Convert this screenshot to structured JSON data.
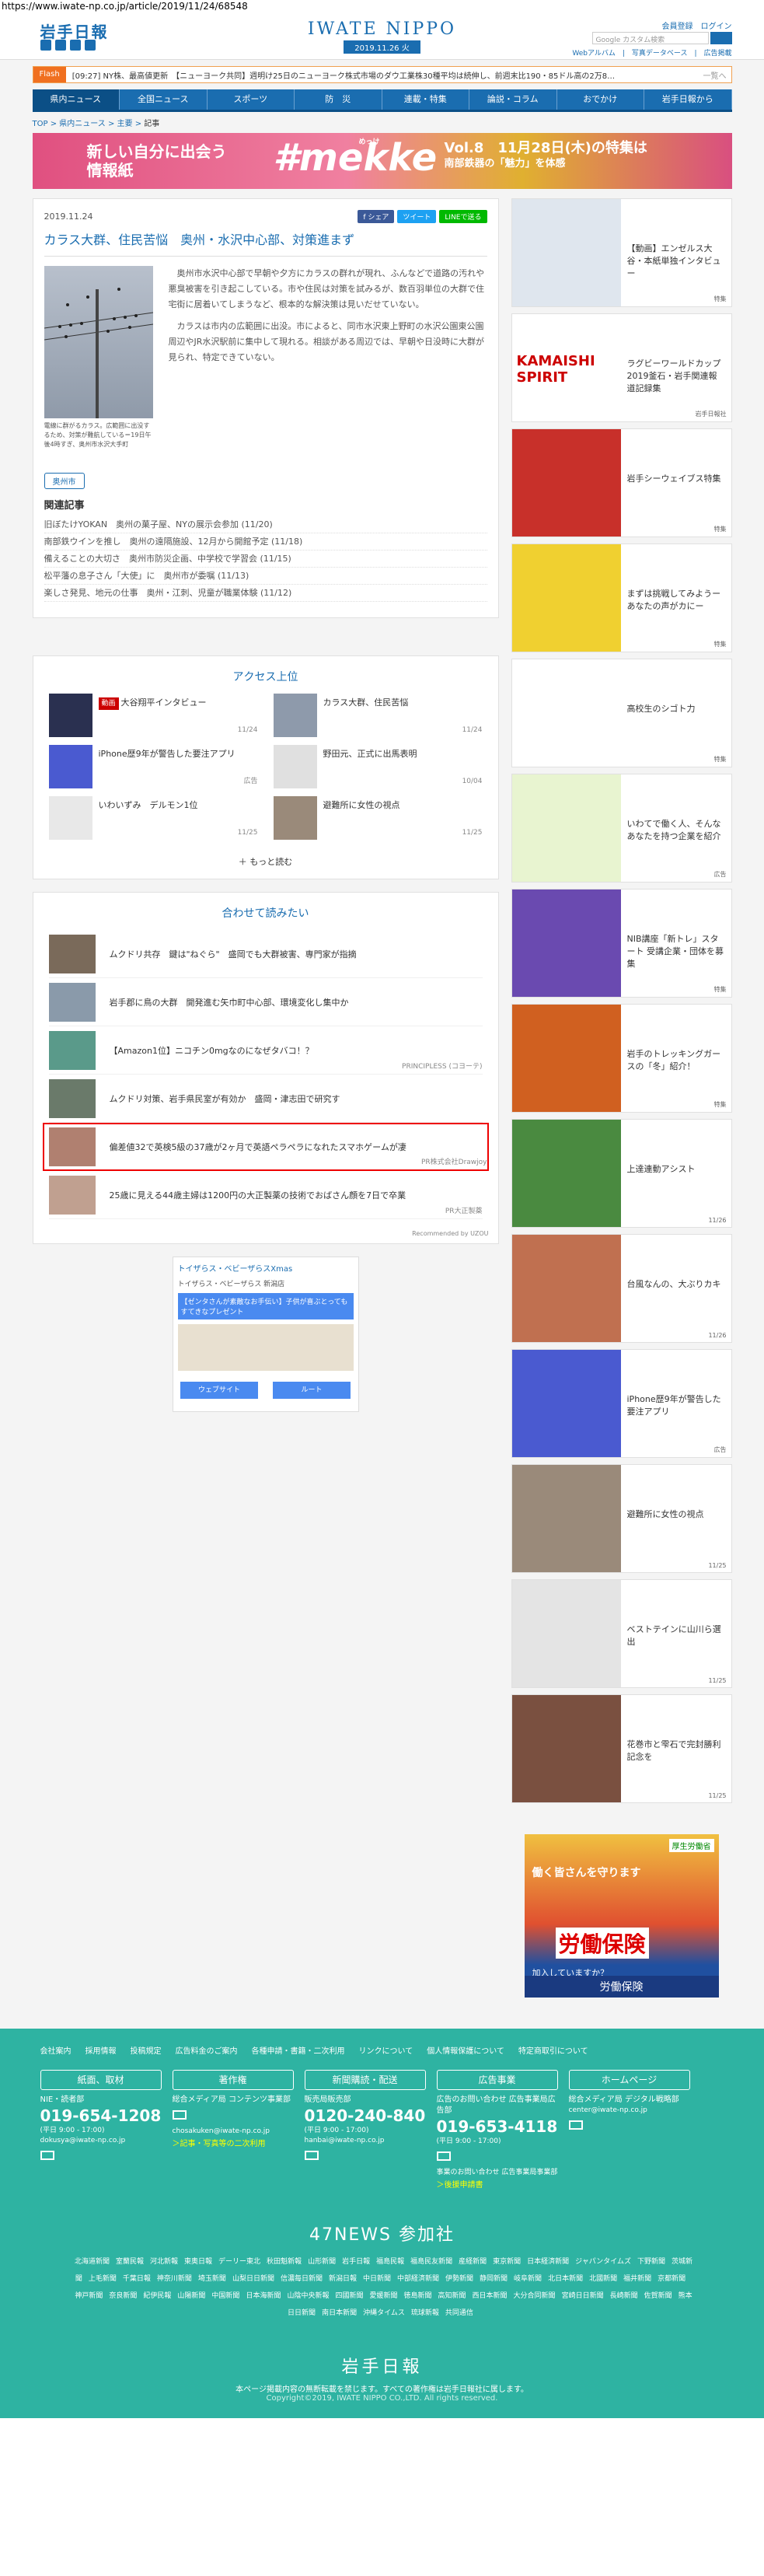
{
  "url": "https://www.iwate-np.co.jp/article/2019/11/24/68548",
  "header": {
    "logo": "岩手日報",
    "brand": "IWATE NIPPO",
    "date": "2019.11.26 火",
    "account": "会員登録　ログイン",
    "search_placeholder": "Google カスタム検索",
    "links": "Webアルバム　|　写真データベース　|　広告掲載"
  },
  "flash": {
    "tag": "Flash",
    "time": "[09:27]",
    "text": "NY株、最高値更新　【ニューヨーク共同】週明け25日のニューヨーク株式市場のダウ工業株30種平均は続伸し、前週末比190・85ドル高の2万8…",
    "more": "一覧へ"
  },
  "nav": [
    "県内ニュース",
    "全国ニュース",
    "スポーツ",
    "防　災",
    "連載・特集",
    "論説・コラム",
    "おでかけ",
    "岩手日報から"
  ],
  "breadcrumb": {
    "a": "TOP",
    "b": "県内ニュース",
    "c": "主要",
    "cur": "記事"
  },
  "banner": {
    "l1": "新しい自分に出会う",
    "l2": "情報紙",
    "logo": "#mekke",
    "kana": "めっけ",
    "vol": "Vol.8　11月28日(木)の特集は",
    "topic": "南部鉄器の「魅力」を体感"
  },
  "article": {
    "date": "2019.11.24",
    "share": [
      "f シェア",
      "ツイート",
      "LINEで送る"
    ],
    "title": "カラス大群、住民苦悩　奥州・水沢中心部、対策進まず",
    "caption": "電線に群がるカラス。広範囲に出没するため、対策が難航している＝19日午後4時すぎ、奥州市水沢大手町",
    "p1": "奥州市水沢中心部で早朝や夕方にカラスの群れが現れ、ふんなどで道路の汚れや悪臭被害を引き起こしている。市や住民は対策を試みるが、数百羽単位の大群で住宅街に居着いてしまうなど、根本的な解決策は見いだせていない。",
    "p2": "カラスは市内の広範囲に出没。市によると、同市水沢東上野町の水沢公園東公園周辺やJR水沢駅前に集中して現れる。相談がある周辺では、早朝や日没時に大群が見られ、特定できていない。",
    "tag": "奥州市",
    "related_title": "関連記事",
    "related": [
      "旧ぼたけYOKAN　奥州の菓子屋、NYの展示会参加 (11/20)",
      "南部鉄ウインを推し　奥州の遠隔施設、12月から開館予定 (11/18)",
      "備えることの大切さ　奥州市防災企画、中学校で学習会 (11/15)",
      "松平藩の息子さん「大使」に　奥州市が委嘱 (11/13)",
      "楽しさ発見、地元の仕事　奥州・江刺、児童が職業体験 (11/12)"
    ]
  },
  "access": {
    "title": "アクセス上位",
    "items": [
      {
        "title": "大谷翔平インタビュー",
        "badge": "動画",
        "date": "11/24"
      },
      {
        "title": "カラス大群、住民苦悩",
        "badge": "",
        "date": "11/24"
      },
      {
        "title": "iPhone歴9年が警告した要注アプリ",
        "badge": "",
        "date": "広告"
      },
      {
        "title": "野田元、正式に出馬表明",
        "badge": "",
        "date": "10/04"
      },
      {
        "title": "いわいずみ　デルモン1位",
        "badge": "",
        "date": "11/25"
      },
      {
        "title": "避難所に女性の視点",
        "badge": "",
        "date": "11/25"
      }
    ],
    "more": "もっと読む"
  },
  "recommend": {
    "title": "合わせて読みたい",
    "items": [
      {
        "title": "ムクドリ共存　鍵は\"ねぐら\"　盛岡でも大群被害、専門家が指摘",
        "pr": ""
      },
      {
        "title": "岩手郡に鳥の大群　開発進む矢巾町中心部、環境変化し集中か",
        "pr": ""
      },
      {
        "title": "【Amazon1位】ニコチン0mgなのになぜタバコ！？",
        "pr": "PRINCIPLESS (コヨーテ)"
      },
      {
        "title": "ムクドリ対策、岩手県民室が有効か　盛岡・津志田で研究す",
        "pr": ""
      },
      {
        "title": "偏差値32で英検5級の37歳が2ヶ月で英語ペラペラになれたスマホゲームが凄",
        "pr": "PR株式会社Drawjoy"
      },
      {
        "title": "25歳に見える44歳主婦は1200円の大正製薬の技術でおばさん顔を7日で卒業",
        "pr": "PR大正製薬"
      }
    ],
    "uzou": "Recommended by UZOU"
  },
  "mini_ad": {
    "title": "トイザらス・ベビーザらスXmas",
    "sub": "トイザらス・ベビーザらス 新潟店",
    "banner": "【ゼンタさんが素敵なお手伝い】子供が喜ぶとってもすてきなプレゼント",
    "route": "ルート",
    "web": "ウェブサイト"
  },
  "side": [
    {
      "title": "【動画】エンゼルス大谷・本紙単独インタビュー",
      "date": "特集"
    },
    {
      "title": "ラグビーワールドカップ2019釜石・岩手関連報道記録集",
      "date": "岩手日報社"
    },
    {
      "title": "岩手シーウェイブス特集",
      "date": "特集"
    },
    {
      "title": "まずは挑戦してみようーあなたの声がカにー",
      "date": "特集"
    },
    {
      "title": "高校生のシゴト力",
      "date": "特集"
    },
    {
      "title": "いわてで働く人、そんなあなたを持つ企業を紹介",
      "date": "広告"
    },
    {
      "title": "NIB講座「新トレ」スタート 受講企業・団体を募集",
      "date": "特集"
    },
    {
      "title": "岩手のトレッキングガースの「冬」紹介！",
      "date": "特集"
    },
    {
      "title": "上達連動アシスト",
      "date": "11/26"
    },
    {
      "title": "台風なんの、大ぶりカキ",
      "date": "11/26"
    },
    {
      "title": "iPhone歴9年が警告した要注アプリ",
      "date": "広告"
    },
    {
      "title": "避難所に女性の視点",
      "date": "11/25"
    },
    {
      "title": "ベストテインに山川ら選出",
      "date": "11/25"
    },
    {
      "title": "花巻市と雫石で完封勝利記念を",
      "date": "11/25"
    }
  ],
  "side_ad": {
    "brand": "厚生労働省",
    "l1": "働く皆さんを守ります",
    "l2": "労働保険",
    "l3": "加入していますか？",
    "bottom": "労働保険"
  },
  "footer": {
    "links": [
      "会社案内",
      "採用情報",
      "投稿規定",
      "広告料金のご案内",
      "各種申請・書籍・二次利用",
      "リンクについて",
      "個人情報保護について",
      "特定商取引について"
    ],
    "cols": [
      {
        "head": "紙面、取材",
        "l1": "NIE・読者部",
        "tel": "019-654-1208",
        "hours": "(平日 9:00 - 17:00)",
        "mail": "dokusya@iwate-np.co.jp",
        "extra": ""
      },
      {
        "head": "著作権",
        "l1": "総合メディア局 コンテンツ事業部",
        "tel": "",
        "hours": "",
        "mail": "chosakuken@iwate-np.co.jp",
        "extra": "＞記事・写真等の二次利用"
      },
      {
        "head": "新聞購読・配送",
        "l1": "販売局販売部",
        "tel": "0120-240-840",
        "hours": "(平日 9:00 - 17:00)",
        "mail": "hanbai@iwate-np.co.jp",
        "extra": ""
      },
      {
        "head": "広告事業",
        "l1": "広告のお問い合わせ 広告事業局広告部",
        "tel": "019-653-4118",
        "hours": "(平日 9:00 - 17:00)",
        "mail": "事業のお問い合わせ 広告事業局事業部",
        "extra": "＞後援申請書"
      },
      {
        "head": "ホームページ",
        "l1": "総合メディア局 デジタル戦略部",
        "tel": "",
        "hours": "",
        "mail": "center@iwate-np.co.jp",
        "extra": ""
      }
    ],
    "news47": "47NEWS 参加社",
    "news_list": [
      "北海道新聞",
      "室蘭民報",
      "河北新報",
      "東奥日報",
      "デーリー東北",
      "秋田魁新報",
      "山形新聞",
      "岩手日報",
      "福島民報",
      "福島民友新聞",
      "産経新聞",
      "東京新聞",
      "日本経済新聞",
      "ジャパンタイムズ",
      "下野新聞",
      "茨城新聞",
      "上毛新聞",
      "千葉日報",
      "神奈川新聞",
      "埼玉新聞",
      "山梨日日新聞",
      "信濃毎日新聞",
      "新潟日報",
      "中日新聞",
      "中部経済新聞",
      "伊勢新聞",
      "静岡新聞",
      "岐阜新聞",
      "北日本新聞",
      "北國新聞",
      "福井新聞",
      "京都新聞",
      "神戸新聞",
      "奈良新聞",
      "紀伊民報",
      "山陽新聞",
      "中国新聞",
      "日本海新聞",
      "山陰中央新報",
      "四國新聞",
      "愛媛新聞",
      "徳島新聞",
      "高知新聞",
      "西日本新聞",
      "大分合同新聞",
      "宮崎日日新聞",
      "長崎新聞",
      "佐賀新聞",
      "熊本日日新聞",
      "南日本新聞",
      "沖縄タイムス",
      "琉球新報",
      "共同通信"
    ],
    "logo": "岩手日報",
    "notice": "本ページ掲載内容の無断転載を禁じます。すべての著作権は岩手日報社に属します。",
    "copy": "Copyright©2019, IWATE NIPPO CO.,LTD. All rights reserved."
  }
}
